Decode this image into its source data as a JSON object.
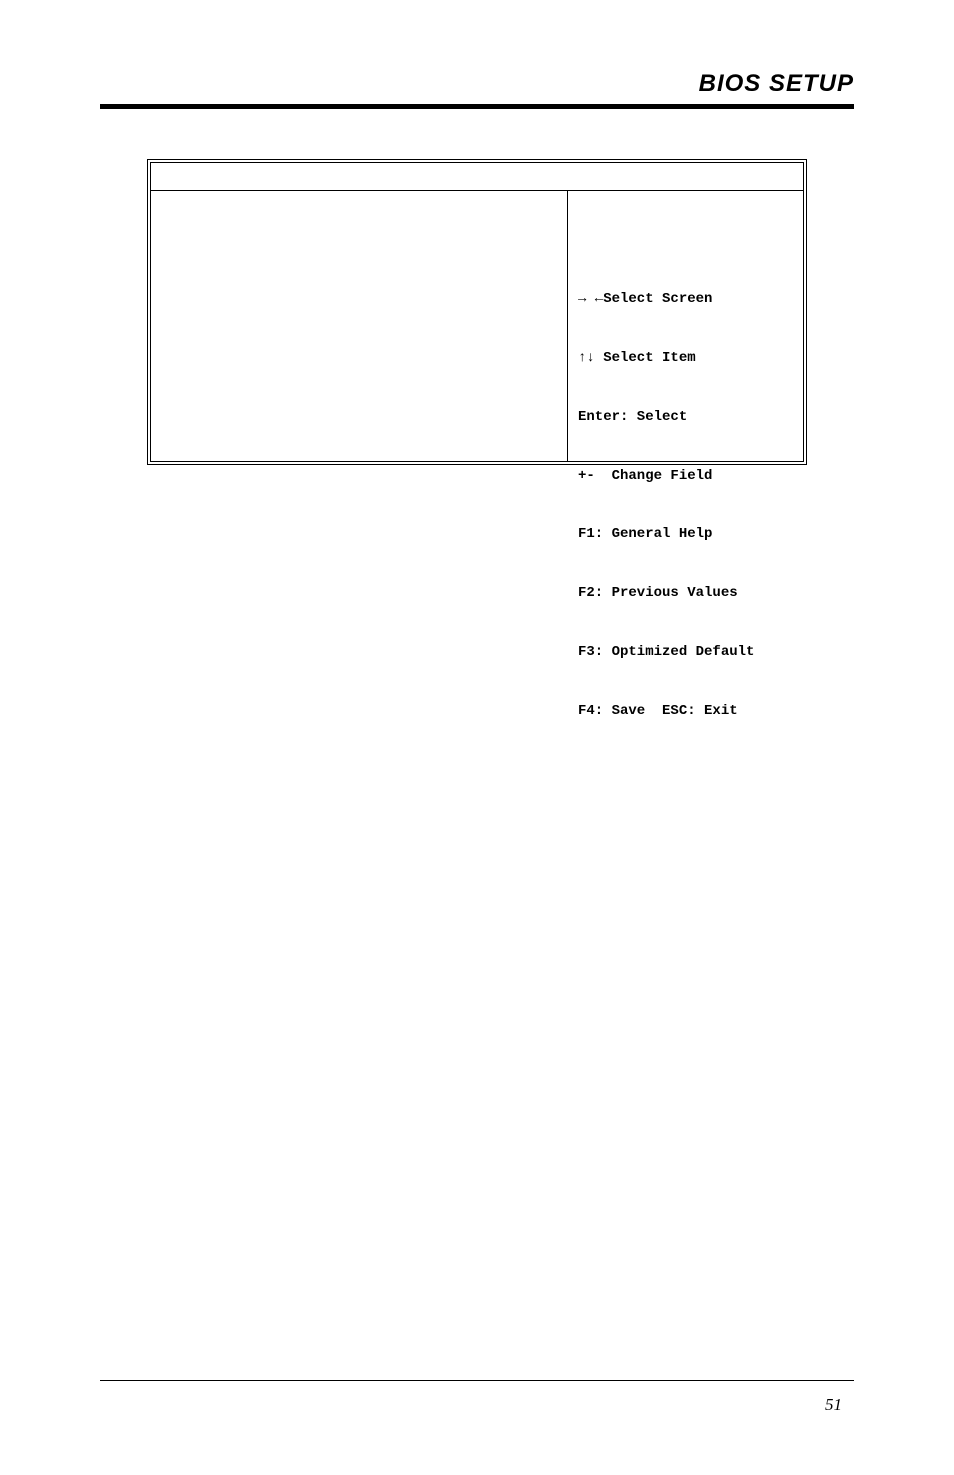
{
  "header": {
    "title": "BIOS SETUP"
  },
  "bios": {
    "help": {
      "select_screen": "→ ←Select Screen",
      "select_item": "↑↓ Select Item",
      "enter": "Enter: Select",
      "change": "+-  Change Field",
      "f1": "F1: General Help",
      "f2": "F2: Previous Values",
      "f3": "F3: Optimized Default",
      "f4": "F4: Save  ESC: Exit"
    }
  },
  "footer": {
    "page_number": "51"
  }
}
